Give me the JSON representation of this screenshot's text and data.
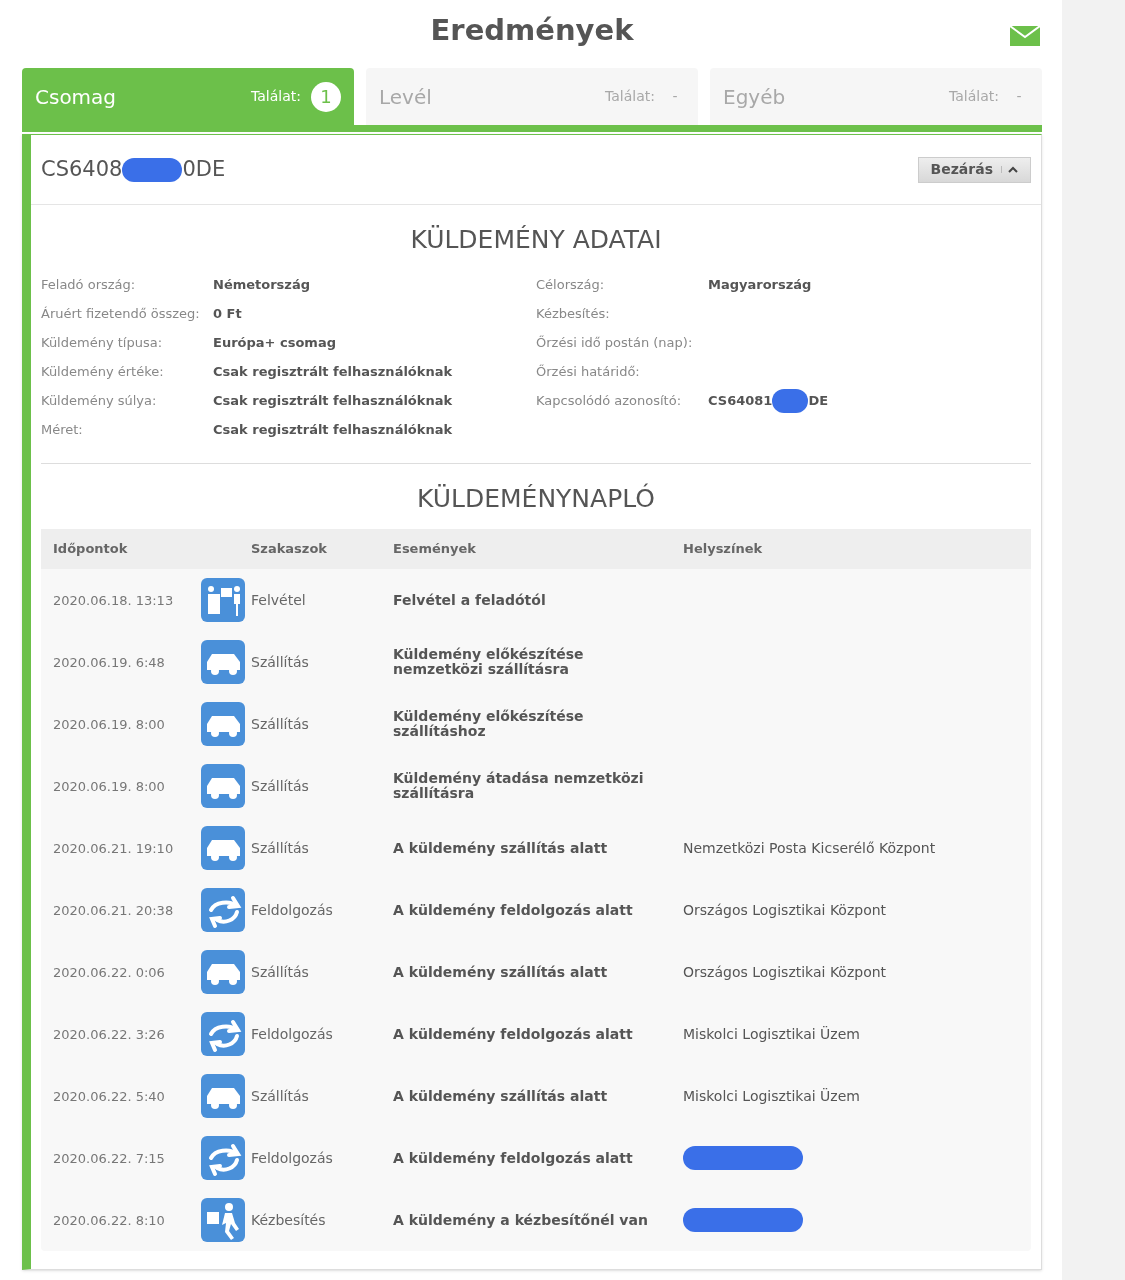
{
  "title": "Eredmények",
  "tabs": [
    {
      "label": "Csomag",
      "count_label": "Találat:",
      "count": "1",
      "selected": true
    },
    {
      "label": "Levél",
      "count_label": "Találat:",
      "count": "-",
      "selected": false
    },
    {
      "label": "Egyéb",
      "count_label": "Találat:",
      "count": "-",
      "selected": false
    }
  ],
  "shipment": {
    "id_start": "CS6408",
    "id_end": "0DE",
    "id_redacted": true,
    "close_button": "Bezárás",
    "expanded": true
  },
  "details": {
    "title": "KÜLDEMÉNY ADATAI",
    "left": [
      {
        "label": "Feladó ország:",
        "value": "Németország"
      },
      {
        "label": "Áruért fizetendő összeg:",
        "value": "0 Ft"
      },
      {
        "label": "Küldemény típusa:",
        "value": "Európa+ csomag"
      },
      {
        "label": "Küldemény értéke:",
        "value": "Csak regisztrált felhasználóknak"
      },
      {
        "label": "Küldemény súlya:",
        "value": "Csak regisztrált felhasználóknak"
      },
      {
        "label": "Méret:",
        "value": "Csak regisztrált felhasználóknak"
      }
    ],
    "right": [
      {
        "label": "Célország:",
        "value": "Magyarország"
      },
      {
        "label": "Kézbesítés:"
      },
      {
        "label": "Őrzési idő postán (nap):"
      },
      {
        "label": "Őrzési határidő:"
      },
      {
        "label": "Kapcsolódó azonosító:",
        "value": "CS64081",
        "value_end": "DE",
        "redacted": true
      }
    ]
  },
  "log": {
    "title": "KÜLDEMÉNYNAPLÓ",
    "columns": [
      "Időpontok",
      "Szakaszok",
      "Események",
      "Helyszínek"
    ],
    "rows": [
      {
        "time": "2020.06.18. 13:13",
        "kind": "pickup",
        "stage": "Felvétel",
        "event": "Felvétel a feladótól",
        "redacted": false
      },
      {
        "time": "2020.06.19. 6:48",
        "kind": "transport",
        "stage": "Szállítás",
        "event": "Küldemény előkészítése nemzetközi szállításra",
        "redacted": false
      },
      {
        "time": "2020.06.19. 8:00",
        "kind": "transport",
        "stage": "Szállítás",
        "event": "Küldemény előkészítése szállításhoz",
        "redacted": false
      },
      {
        "time": "2020.06.19. 8:00",
        "kind": "transport",
        "stage": "Szállítás",
        "event": "Küldemény átadása nemzetközi szállításra",
        "redacted": false
      },
      {
        "time": "2020.06.21. 19:10",
        "kind": "transport",
        "stage": "Szállítás",
        "event": "A küldemény szállítás alatt",
        "location": "Nemzetközi Posta Kicserélő Központ",
        "redacted": false
      },
      {
        "time": "2020.06.21. 20:38",
        "kind": "processing",
        "stage": "Feldolgozás",
        "event": "A küldemény feldolgozás alatt",
        "location": "Országos Logisztikai Központ",
        "redacted": false
      },
      {
        "time": "2020.06.22. 0:06",
        "kind": "transport",
        "stage": "Szállítás",
        "event": "A küldemény szállítás alatt",
        "location": "Országos Logisztikai Központ",
        "redacted": false
      },
      {
        "time": "2020.06.22. 3:26",
        "kind": "processing",
        "stage": "Feldolgozás",
        "event": "A küldemény feldolgozás alatt",
        "location": "Miskolci Logisztikai Üzem",
        "redacted": false
      },
      {
        "time": "2020.06.22. 5:40",
        "kind": "transport",
        "stage": "Szállítás",
        "event": "A küldemény szállítás alatt",
        "location": "Miskolci Logisztikai Üzem",
        "redacted": false
      },
      {
        "time": "2020.06.22. 7:15",
        "kind": "processing",
        "stage": "Feldolgozás",
        "event": "A küldemény feldolgozás alatt",
        "redacted": true
      },
      {
        "time": "2020.06.22. 8:10",
        "kind": "delivery",
        "stage": "Kézbesítés",
        "event": "A küldemény a kézbesítőnél van",
        "redacted": true
      }
    ]
  }
}
